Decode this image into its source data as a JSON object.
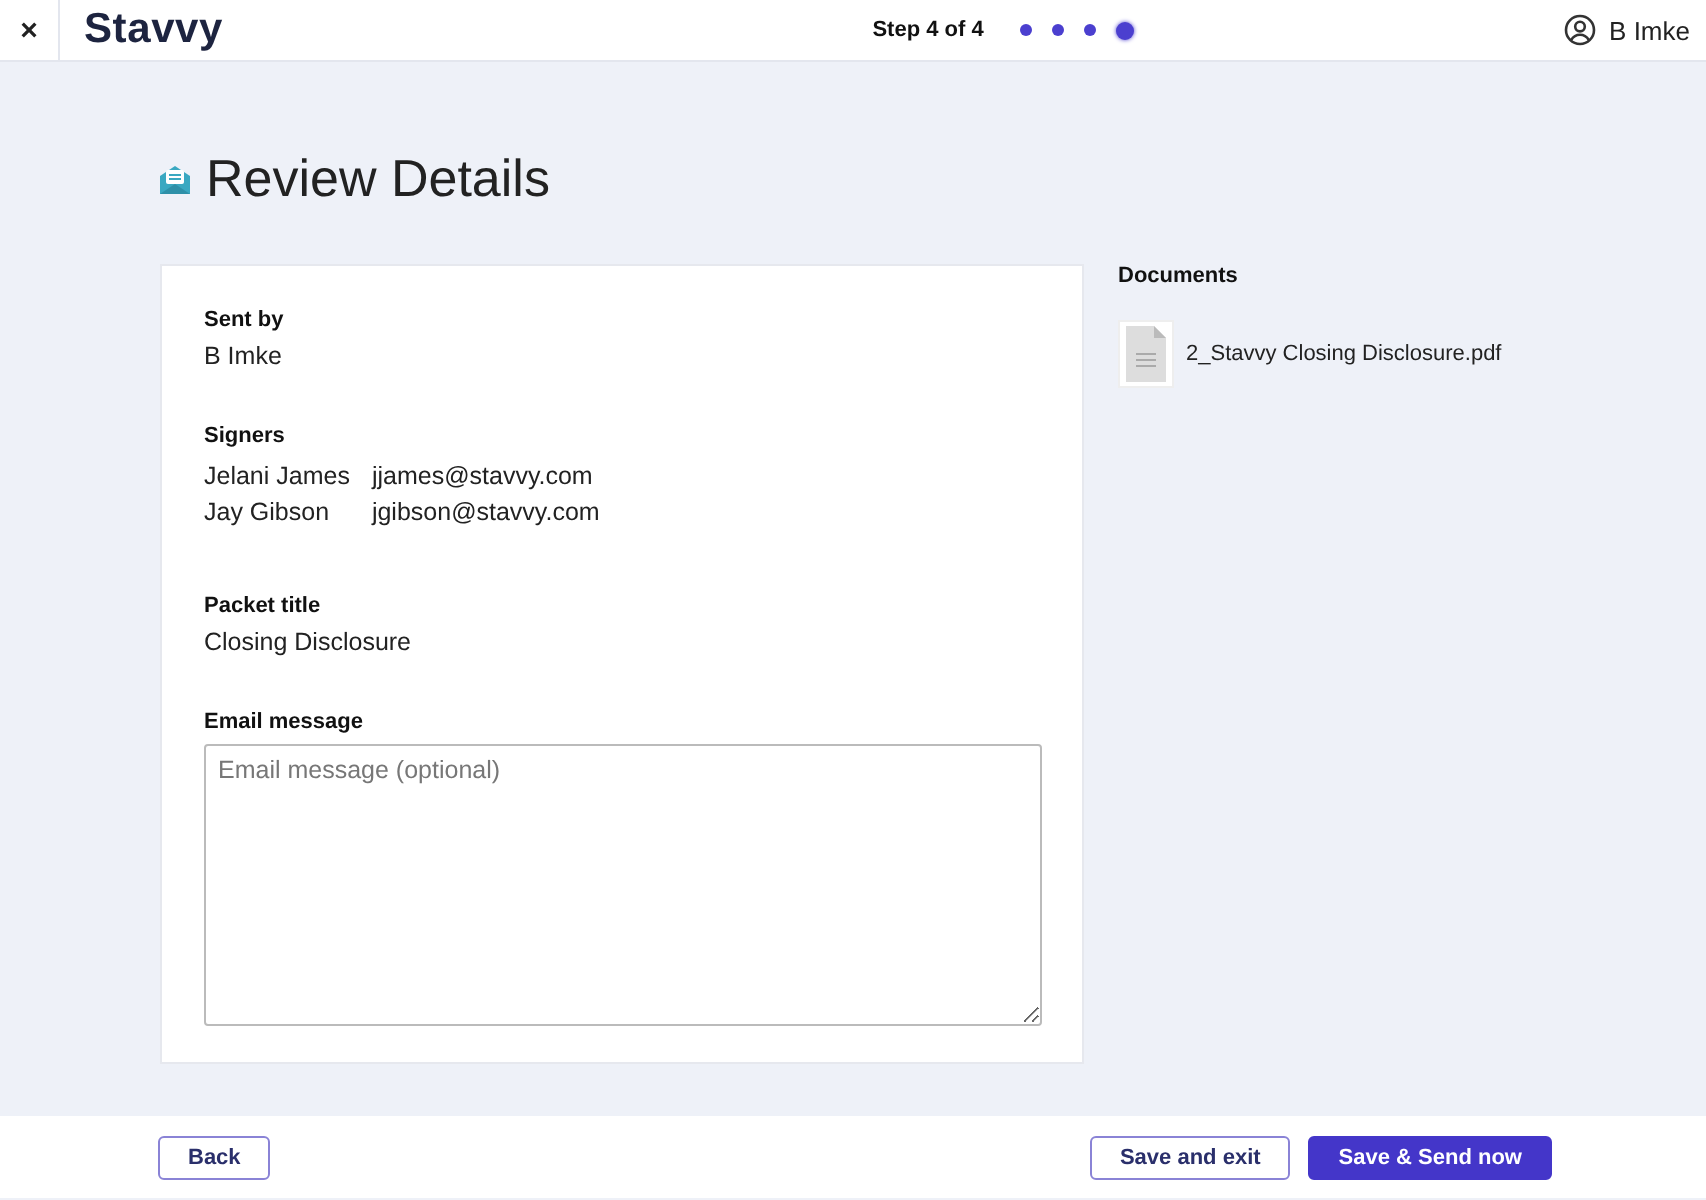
{
  "header": {
    "close": "×",
    "logo": "Stavvy",
    "step_label": "Step 4 of 4",
    "steps": [
      {
        "selected": false
      },
      {
        "selected": false
      },
      {
        "selected": false
      },
      {
        "selected": true
      }
    ],
    "user": "B Imke"
  },
  "title": "Review Details",
  "details": {
    "sent_by": {
      "label": "Sent by",
      "value": "B Imke"
    },
    "signers": {
      "label": "Signers",
      "rows": [
        {
          "name": "Jelani James",
          "email": "jjames@stavvy.com"
        },
        {
          "name": "Jay Gibson",
          "email": "jgibson@stavvy.com"
        }
      ]
    },
    "packet_title": {
      "label": "Packet title",
      "value": "Closing Disclosure"
    },
    "email_message": {
      "label": "Email message",
      "placeholder": "Email message (optional)"
    }
  },
  "documents": {
    "heading": "Documents",
    "files": [
      "2_Stavvy Closing Disclosure.pdf"
    ]
  },
  "footer": {
    "back": "Back",
    "save_exit": "Save and exit",
    "send": "Save & Send now"
  }
}
